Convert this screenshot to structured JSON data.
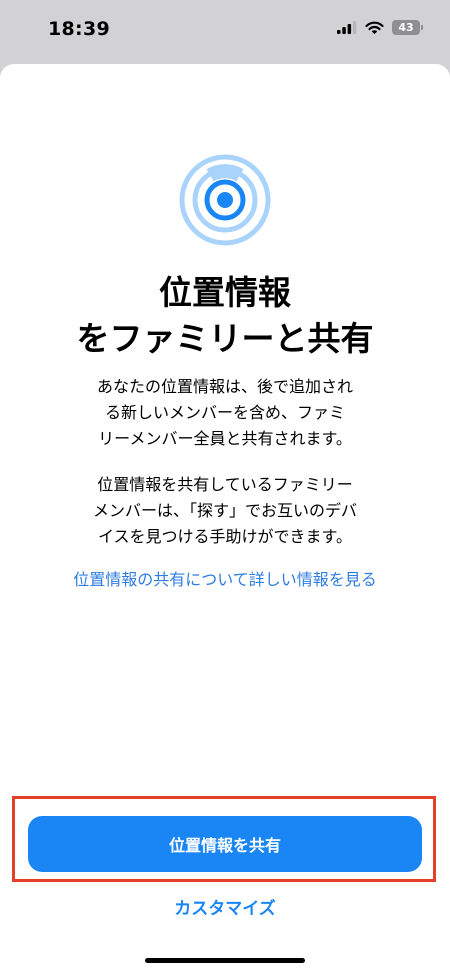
{
  "status_bar": {
    "time": "18:39",
    "battery_level": "43"
  },
  "title": {
    "line1": "位置情報",
    "line2": "をファミリーと共有"
  },
  "description": {
    "paragraph1": [
      "あなたの位置情報は、後で追加され",
      "る新しいメンバーを含め、ファミ",
      "リーメンバー全員と共有されます。"
    ],
    "paragraph2": [
      "位置情報を共有しているファミリー",
      "メンバーは、「探す」でお互いのデバ",
      "イスを見つける手助けができます。"
    ]
  },
  "learn_more_link": "位置情報の共有について詳しい情報を見る",
  "share_button_label": "位置情報を共有",
  "customize_link": "カスタマイズ",
  "colors": {
    "accent": "#1a86f5",
    "link": "#2f7de1",
    "highlight": "#e4412b",
    "icon_light": "#a9d3fb",
    "icon_dark": "#1a86f5"
  },
  "icons": {
    "hero": "location-share-icon",
    "signal": "cellular-signal-icon",
    "wifi": "wifi-icon",
    "battery": "battery-icon"
  }
}
